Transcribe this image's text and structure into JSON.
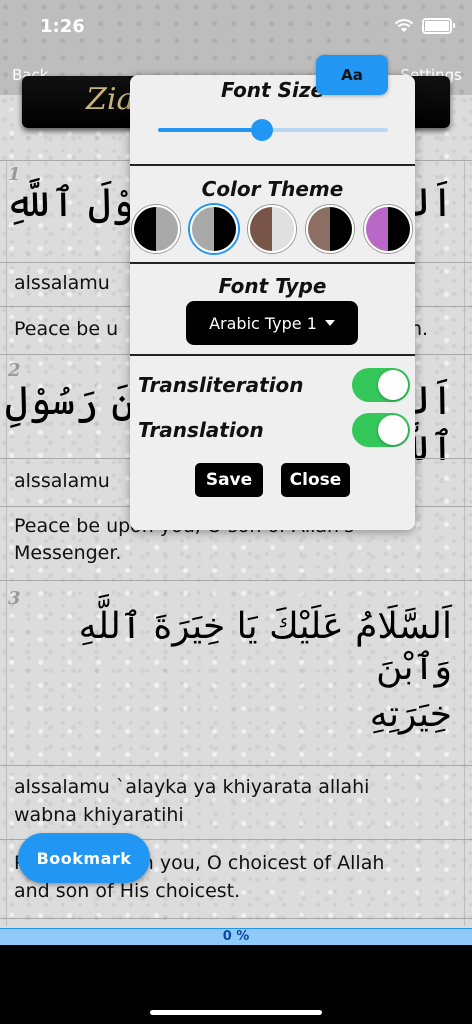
{
  "status": {
    "time": "1:26"
  },
  "nav": {
    "back": "Back",
    "settings": "Settings",
    "title": "Zia"
  },
  "font_button": {
    "label": "Aa"
  },
  "rows": [
    {
      "number": "1",
      "arabic": "اَلسَّلَامُ عَلَيْكَ يَا رَسُوْلَ ٱللَّهِ",
      "transliteration": "alssalamu",
      "translation": "Peace be u",
      "translation_tail": "h."
    },
    {
      "number": "2",
      "arabic": "اَلسَّلَامُ عَلَيْكَ يَا ٱبْنَ رَسُوْلِ ٱللَّهِ",
      "transliteration": "alssalamu",
      "translation_line1": "Peace be upon you, O son of Allah's",
      "translation_line2": "Messenger."
    },
    {
      "number": "3",
      "arabic_line1": "اَلسَّلَامُ عَلَيْكَ يَا خِيَرَةَ ٱللَّهِ وَٱبْنَ",
      "arabic_line2": "خِيَرَتِهِ",
      "transliteration_line1": "alssalamu `alayka ya khiyarata allahi",
      "transliteration_line2": "wabna khiyaratihi",
      "translation_line1": "Peace be upon you, O choicest of Allah",
      "translation_line2": "and son of His choicest."
    }
  ],
  "settings_panel": {
    "font_size_title": "Font Size",
    "font_size_value": 0.45,
    "color_theme_title": "Color Theme",
    "themes": [
      {
        "left": "#000000",
        "right": "#a9a9a9"
      },
      {
        "left": "#a9a9a9",
        "right": "#000000"
      },
      {
        "left": "#795548",
        "right": "#e0e0e0"
      },
      {
        "left": "#8d6e63",
        "right": "#000000"
      },
      {
        "left": "#ba68c8",
        "right": "#000000"
      }
    ],
    "selected_theme": 1,
    "font_type_title": "Font Type",
    "font_type_value": "Arabic Type 1",
    "transliteration_label": "Transliteration",
    "translation_label": "Translation",
    "transliteration_on": true,
    "translation_on": true,
    "save_label": "Save",
    "close_label": "Close"
  },
  "bookmark": {
    "label": "Bookmark"
  },
  "progress": {
    "text": "0 %",
    "value": 0
  },
  "colors": {
    "accent": "#2196f3",
    "toggle_on": "#34c759"
  }
}
